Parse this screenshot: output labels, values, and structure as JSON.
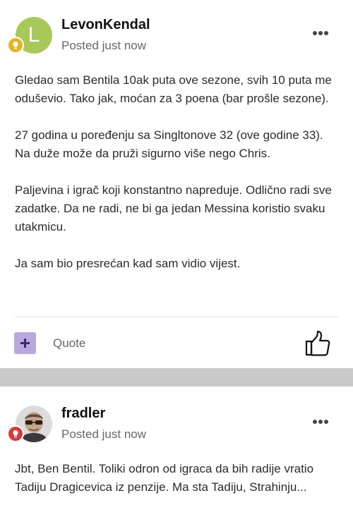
{
  "posts": [
    {
      "avatar_letter": "L",
      "username": "LevonKendal",
      "posted": "Posted just now",
      "paragraphs": [
        "Gledao sam Bentila 10ak puta ove sezone, svih 10 puta me oduševio. Tako jak, moćan za 3 poena (bar prošle sezone).",
        "27 godina u poređenju sa Singltonove 32 (ove godine 33). Na duže može da pruži sigurno više nego Chris.",
        "Paljevina i igrač koji konstantno napreduje. Odlično radi sve zadatke. Da ne radi, ne bi ga jedan Messina koristio svaku utakmicu.",
        "Ja sam bio presrećan kad sam vidio vijest."
      ],
      "quote_label": "Quote",
      "badge_color": "#e6b125"
    },
    {
      "username": "fradler",
      "posted": "Posted just now",
      "paragraphs": [
        "Jbt, Ben Bentil. Toliki odron od igraca da bih radije vratio Tadiju Dragicevica iz penzije. Ma sta Tadiju, Strahinju..."
      ],
      "badge_color": "#d33b3b"
    }
  ]
}
